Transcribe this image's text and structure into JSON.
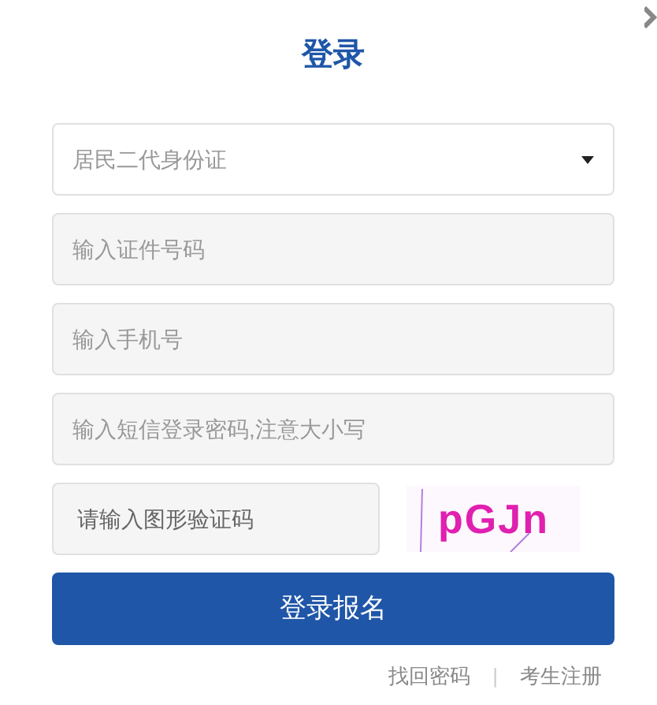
{
  "title": "登录",
  "id_type": {
    "value": "居民二代身份证"
  },
  "fields": [
    {
      "placeholder": "输入证件号码"
    },
    {
      "placeholder": "输入手机号"
    },
    {
      "placeholder": "输入短信登录密码,注意大小写"
    }
  ],
  "captcha": {
    "placeholder": "请输入图形验证码",
    "code": "pGJn"
  },
  "submit": "登录报名",
  "links": [
    "找回密码",
    "考生注册"
  ],
  "separator": "|"
}
